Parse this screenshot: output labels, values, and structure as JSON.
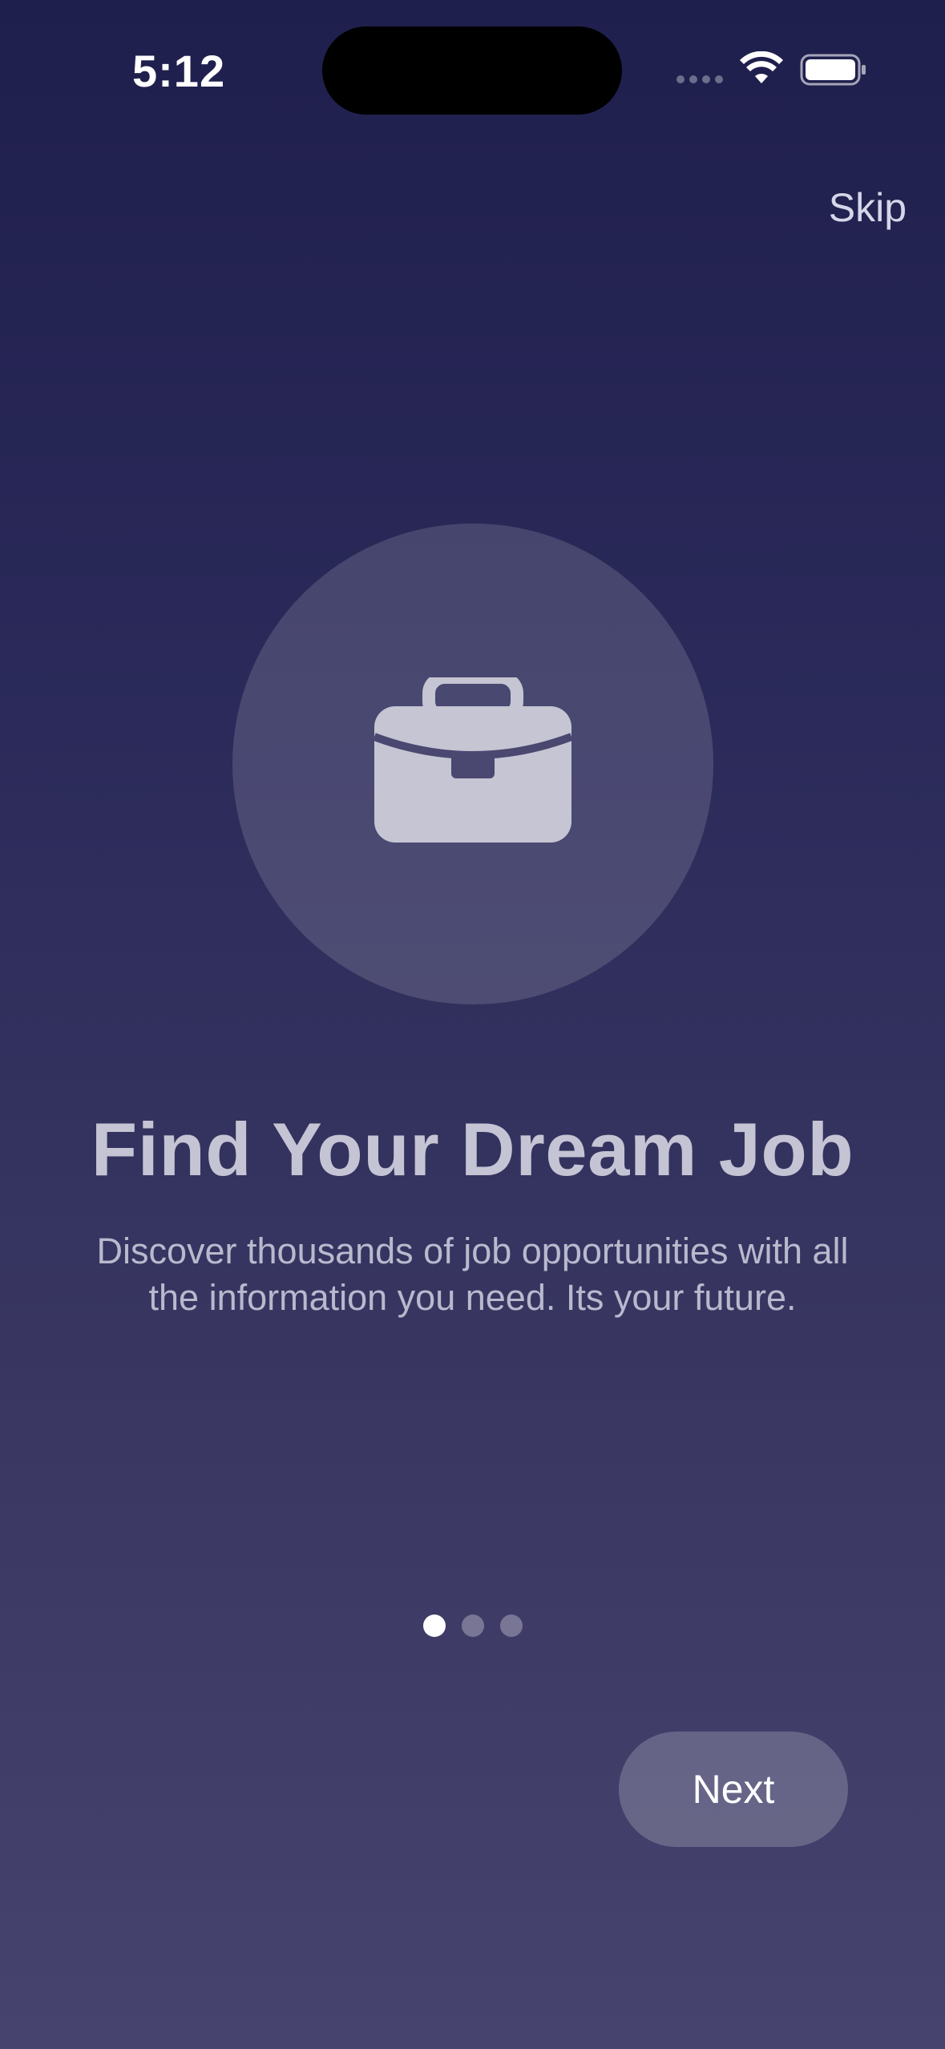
{
  "status_bar": {
    "time": "5:12"
  },
  "header": {
    "skip_label": "Skip"
  },
  "hero": {
    "icon": "briefcase-icon"
  },
  "content": {
    "title": "Find Your Dream Job",
    "description": "Discover thousands of job opportunities with all the information you need. Its your future."
  },
  "pagination": {
    "total_pages": 3,
    "current_page": 1
  },
  "footer": {
    "next_label": "Next"
  },
  "colors": {
    "background_top": "#1f1f4d",
    "background_bottom": "#46446e",
    "title": "#c4c4d4",
    "description": "#b9b9ce"
  }
}
